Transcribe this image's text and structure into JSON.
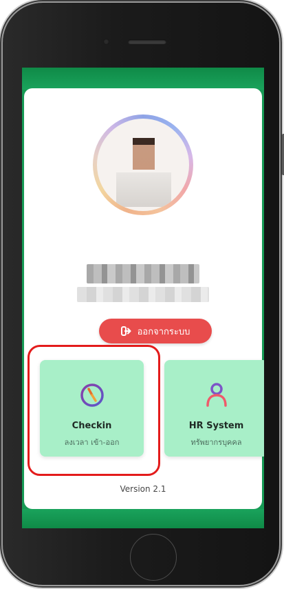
{
  "profile": {
    "avatar_icon": "profile-photo-pixelated"
  },
  "logout": {
    "icon": "sign-out-icon",
    "label": "ออกจากระบบ",
    "color": "#e84c4c"
  },
  "tiles": [
    {
      "icon": "clock-icon",
      "title": "Checkin",
      "subtitle": "ลงเวลา เข้า-ออก"
    },
    {
      "icon": "user-icon",
      "title": "HR System",
      "subtitle": "ทรัพยากรบุคคล"
    }
  ],
  "version": "Version 2.1",
  "colors": {
    "brand_green": "#179a55",
    "tile_bg": "#a8efc8",
    "highlight": "#e31b1b"
  }
}
